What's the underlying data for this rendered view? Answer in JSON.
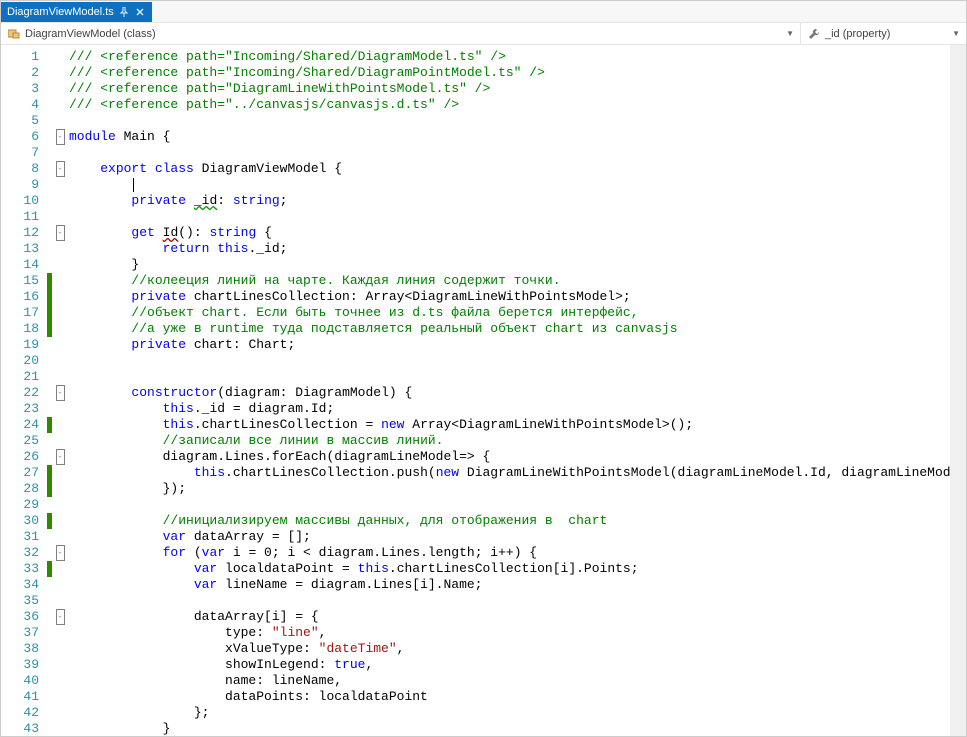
{
  "tab": {
    "title": "DiagramViewModel.ts"
  },
  "nav": {
    "class_icon": "class-icon",
    "class_label": "DiagramViewModel (class)",
    "member_icon": "wrench-icon",
    "member_label": "_id (property)"
  },
  "gutter": [
    "1",
    "2",
    "3",
    "4",
    "5",
    "6",
    "7",
    "8",
    "9",
    "10",
    "11",
    "12",
    "13",
    "14",
    "15",
    "16",
    "17",
    "18",
    "19",
    "20",
    "21",
    "22",
    "23",
    "24",
    "25",
    "26",
    "27",
    "28",
    "29",
    "30",
    "31",
    "32",
    "33",
    "34",
    "35",
    "36",
    "37",
    "38",
    "39",
    "40",
    "41",
    "42",
    "43"
  ],
  "fold": {
    "6": "-",
    "8": "-",
    "12": "-",
    "22": "-",
    "26": "-",
    "32": "-",
    "36": "-"
  },
  "marks": {
    "15": "g",
    "16": "g",
    "17": "g",
    "18": "g",
    "24": "g",
    "27": "g",
    "28": "g",
    "30": "g",
    "33": "g"
  },
  "code": [
    [
      [
        "com",
        "/// <reference path=\"Incoming/Shared/DiagramModel.ts\" />"
      ]
    ],
    [
      [
        "com",
        "/// <reference path=\"Incoming/Shared/DiagramPointModel.ts\" />"
      ]
    ],
    [
      [
        "com",
        "/// <reference path=\"DiagramLineWithPointsModel.ts\" />"
      ]
    ],
    [
      [
        "com",
        "/// <reference path=\"../canvasjs/canvasjs.d.ts\" />"
      ]
    ],
    [],
    [
      [
        "kw",
        "module"
      ],
      [
        "p",
        " Main {"
      ]
    ],
    [],
    [
      [
        "p",
        "    "
      ],
      [
        "kw",
        "export class"
      ],
      [
        "p",
        " DiagramViewModel {"
      ]
    ],
    [
      [
        "p",
        "        "
      ],
      [
        "caret",
        ""
      ]
    ],
    [
      [
        "p",
        "        "
      ],
      [
        "kw",
        "private"
      ],
      [
        "p",
        " "
      ],
      [
        "sqg",
        "_id"
      ],
      [
        "p",
        ": "
      ],
      [
        "kw",
        "string"
      ],
      [
        "p",
        ";"
      ]
    ],
    [],
    [
      [
        "p",
        "        "
      ],
      [
        "kw",
        "get"
      ],
      [
        "p",
        " "
      ],
      [
        "sq",
        "Id"
      ],
      [
        "p",
        "(): "
      ],
      [
        "kw",
        "string"
      ],
      [
        "p",
        " {"
      ]
    ],
    [
      [
        "p",
        "            "
      ],
      [
        "kw",
        "return this"
      ],
      [
        "p",
        "._id;"
      ]
    ],
    [
      [
        "p",
        "        }"
      ]
    ],
    [
      [
        "p",
        "        "
      ],
      [
        "com",
        "//колееция линий на чарте. Каждая линия содержит точки."
      ]
    ],
    [
      [
        "p",
        "        "
      ],
      [
        "kw",
        "private"
      ],
      [
        "p",
        " chartLinesCollection: Array<DiagramLineWithPointsModel>;"
      ]
    ],
    [
      [
        "p",
        "        "
      ],
      [
        "com",
        "//объект chart. Если быть точнее из d.ts файла берется интерфейс,"
      ]
    ],
    [
      [
        "p",
        "        "
      ],
      [
        "com",
        "//а уже в runtime туда подставляется реальный объект chart из canvasjs"
      ]
    ],
    [
      [
        "p",
        "        "
      ],
      [
        "kw",
        "private"
      ],
      [
        "p",
        " chart: Chart;"
      ]
    ],
    [],
    [],
    [
      [
        "p",
        "        "
      ],
      [
        "kw",
        "constructor"
      ],
      [
        "p",
        "(diagram: DiagramModel) {"
      ]
    ],
    [
      [
        "p",
        "            "
      ],
      [
        "kw",
        "this"
      ],
      [
        "p",
        "._id = diagram.Id;"
      ]
    ],
    [
      [
        "p",
        "            "
      ],
      [
        "kw",
        "this"
      ],
      [
        "p",
        ".chartLinesCollection = "
      ],
      [
        "kw",
        "new"
      ],
      [
        "p",
        " Array<DiagramLineWithPointsModel>();"
      ]
    ],
    [
      [
        "p",
        "            "
      ],
      [
        "com",
        "//записали все линии в массив линий."
      ]
    ],
    [
      [
        "p",
        "            diagram.Lines.forEach(diagramLineModel=> {"
      ]
    ],
    [
      [
        "p",
        "                "
      ],
      [
        "kw",
        "this"
      ],
      [
        "p",
        ".chartLinesCollection.push("
      ],
      [
        "kw",
        "new"
      ],
      [
        "p",
        " DiagramLineWithPointsModel(diagramLineModel.Id, diagramLineModel.Name));"
      ]
    ],
    [
      [
        "p",
        "            });"
      ]
    ],
    [],
    [
      [
        "p",
        "            "
      ],
      [
        "com",
        "//инициализируем массивы данных, для отображения в  chart"
      ]
    ],
    [
      [
        "p",
        "            "
      ],
      [
        "kw",
        "var"
      ],
      [
        "p",
        " dataArray = [];"
      ]
    ],
    [
      [
        "p",
        "            "
      ],
      [
        "kw",
        "for"
      ],
      [
        "p",
        " ("
      ],
      [
        "kw",
        "var"
      ],
      [
        "p",
        " i = 0; i < diagram.Lines.length; i++) {"
      ]
    ],
    [
      [
        "p",
        "                "
      ],
      [
        "kw",
        "var"
      ],
      [
        "p",
        " localdataPoint = "
      ],
      [
        "kw",
        "this"
      ],
      [
        "p",
        ".chartLinesCollection[i].Points;"
      ]
    ],
    [
      [
        "p",
        "                "
      ],
      [
        "kw",
        "var"
      ],
      [
        "p",
        " lineName = diagram.Lines[i].Name;"
      ]
    ],
    [],
    [
      [
        "p",
        "                dataArray[i] = {"
      ]
    ],
    [
      [
        "p",
        "                    type: "
      ],
      [
        "str",
        "\"line\""
      ],
      [
        "p",
        ","
      ]
    ],
    [
      [
        "p",
        "                    xValueType: "
      ],
      [
        "str",
        "\"dateTime\""
      ],
      [
        "p",
        ","
      ]
    ],
    [
      [
        "p",
        "                    showInLegend: "
      ],
      [
        "kw",
        "true"
      ],
      [
        "p",
        ","
      ]
    ],
    [
      [
        "p",
        "                    name: lineName,"
      ]
    ],
    [
      [
        "p",
        "                    dataPoints: localdataPoint"
      ]
    ],
    [
      [
        "p",
        "                };"
      ]
    ],
    [
      [
        "p",
        "            }"
      ]
    ]
  ]
}
